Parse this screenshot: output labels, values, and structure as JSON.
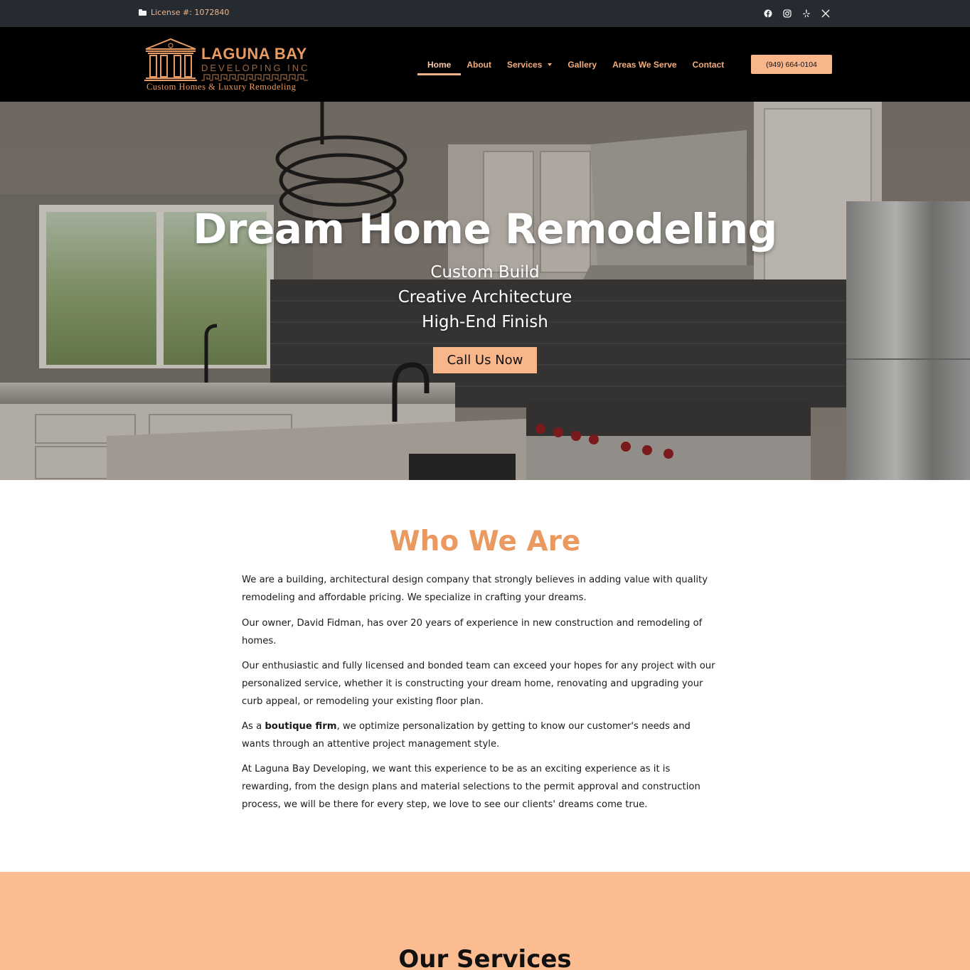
{
  "topbar": {
    "license": "License #: 1072840",
    "socials": [
      "facebook-icon",
      "instagram-icon",
      "yelp-icon",
      "x-icon"
    ]
  },
  "header": {
    "logo": {
      "name": "LAGUNA BAY",
      "sub": "DEVELOPING INC",
      "tagline": "Custom Homes & Luxury Remodeling"
    },
    "nav": [
      {
        "label": "Home",
        "active": true
      },
      {
        "label": "About"
      },
      {
        "label": "Services",
        "has_dropdown": true
      },
      {
        "label": "Gallery"
      },
      {
        "label": "Areas We Serve"
      },
      {
        "label": "Contact"
      }
    ],
    "phone": "(949) 664-0104"
  },
  "hero": {
    "title": "Dream Home Remodeling",
    "lines": [
      "Custom Build",
      "Creative Architecture",
      "High-End Finish"
    ],
    "cta": "Call Us Now"
  },
  "who": {
    "title": "Who We Are",
    "p1": "We are a building, architectural design company that strongly believes in adding value with quality remodeling and affordable pricing. We specialize in crafting your dreams.",
    "p2": "Our owner, David Fidman, has over 20 years of experience in new construction and remodeling of homes.",
    "p3": "Our enthusiastic and fully licensed and bonded team can exceed your hopes for any project with our personalized service, whether it is constructing your dream home, renovating and upgrading your curb appeal, or remodeling your existing floor plan.",
    "p4_before": "As a ",
    "p4_bold": "boutique firm",
    "p4_after": ", we optimize personalization by getting to know our customer's needs and wants through an attentive project management style.",
    "p5": "At Laguna Bay Developing, we want this experience to be as an exciting experience as it is rewarding, from the design plans and material selections to the permit approval and construction process, we will be there for every step, we love to see our clients' dreams come true."
  },
  "services": {
    "title": "Our Services"
  },
  "colors": {
    "accent": "#f8b68a",
    "heading_orange": "#ea9a60",
    "topbar_bg": "#262a31",
    "services_bg": "#fcbc91"
  }
}
